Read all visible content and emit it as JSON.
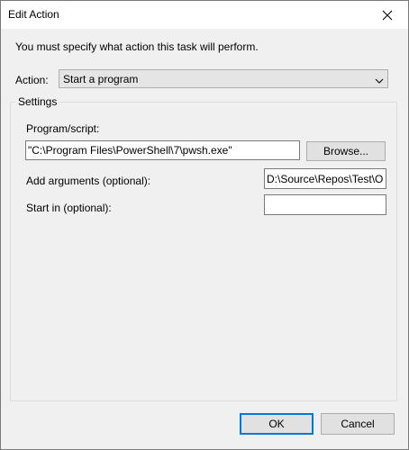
{
  "window": {
    "title": "Edit Action"
  },
  "instruction": "You must specify what action this task will perform.",
  "action": {
    "label": "Action:",
    "selected": "Start a program"
  },
  "settings": {
    "legend": "Settings",
    "program_label": "Program/script:",
    "program_value": "\"C:\\Program Files\\PowerShell\\7\\pwsh.exe\"",
    "browse_label": "Browse...",
    "args_label": "Add arguments (optional):",
    "args_value": "D:\\Source\\Repos\\Test\\O",
    "startin_label": "Start in (optional):",
    "startin_value": ""
  },
  "buttons": {
    "ok": "OK",
    "cancel": "Cancel"
  },
  "colors": {
    "default_button_border": "#0078d7",
    "dialog_background": "#f0f0f0"
  },
  "icons": {
    "close": "close-icon",
    "dropdown": "chevron-down-icon"
  }
}
